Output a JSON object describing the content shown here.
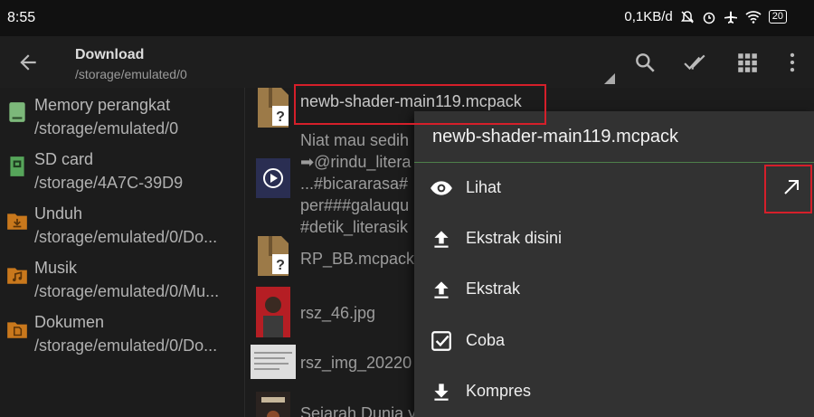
{
  "status": {
    "time": "8:55",
    "speed": "0,1KB/d",
    "battery": "20"
  },
  "header": {
    "title": "Download",
    "subtitle": "/storage/emulated/0"
  },
  "sidebar": {
    "items": [
      {
        "label": "Memory perangkat",
        "path": "/storage/emulated/0",
        "icon": "device-storage-icon",
        "color": "#7cb87a"
      },
      {
        "label": "SD card",
        "path": "/storage/4A7C-39D9",
        "icon": "sd-card-icon",
        "color": "#56a55a"
      },
      {
        "label": "Unduh",
        "path": "/storage/emulated/0/Do...",
        "icon": "folder-download-icon",
        "color": "#c9781c"
      },
      {
        "label": "Musik",
        "path": "/storage/emulated/0/Mu...",
        "icon": "folder-music-icon",
        "color": "#c9781c"
      },
      {
        "label": "Dokumen",
        "path": "/storage/emulated/0/Do...",
        "icon": "folder-document-icon",
        "color": "#c9781c"
      }
    ]
  },
  "files": [
    {
      "name": "newb-shader-main119.mcpack",
      "icon": "archive-unknown-icon"
    },
    {
      "lines": [
        "Niat mau sedih",
        "➡@rindu_litera",
        "...#bicararasa#",
        "per###galauqu",
        "#detik_literasik"
      ],
      "icon": "video-play-icon"
    },
    {
      "name": "RP_BB.mcpack",
      "icon": "archive-unknown-icon"
    },
    {
      "name": "rsz_46.jpg",
      "icon": "photo-thumbnail"
    },
    {
      "name": "rsz_img_20220",
      "icon": "document-thumbnail"
    },
    {
      "name": "Sejarah Dunia y",
      "icon": "book-thumbnail"
    }
  ],
  "menu": {
    "title": "newb-shader-main119.mcpack",
    "items": [
      {
        "label": "Lihat",
        "icon": "eye-icon"
      },
      {
        "label": "Ekstrak disini",
        "icon": "upload-icon"
      },
      {
        "label": "Ekstrak",
        "icon": "upload-icon"
      },
      {
        "label": "Coba",
        "icon": "checkbox-icon"
      },
      {
        "label": "Kompres",
        "icon": "download-icon"
      }
    ]
  },
  "colors": {
    "accent_divider": "#4e7f4a",
    "highlight": "#d51f2a"
  }
}
